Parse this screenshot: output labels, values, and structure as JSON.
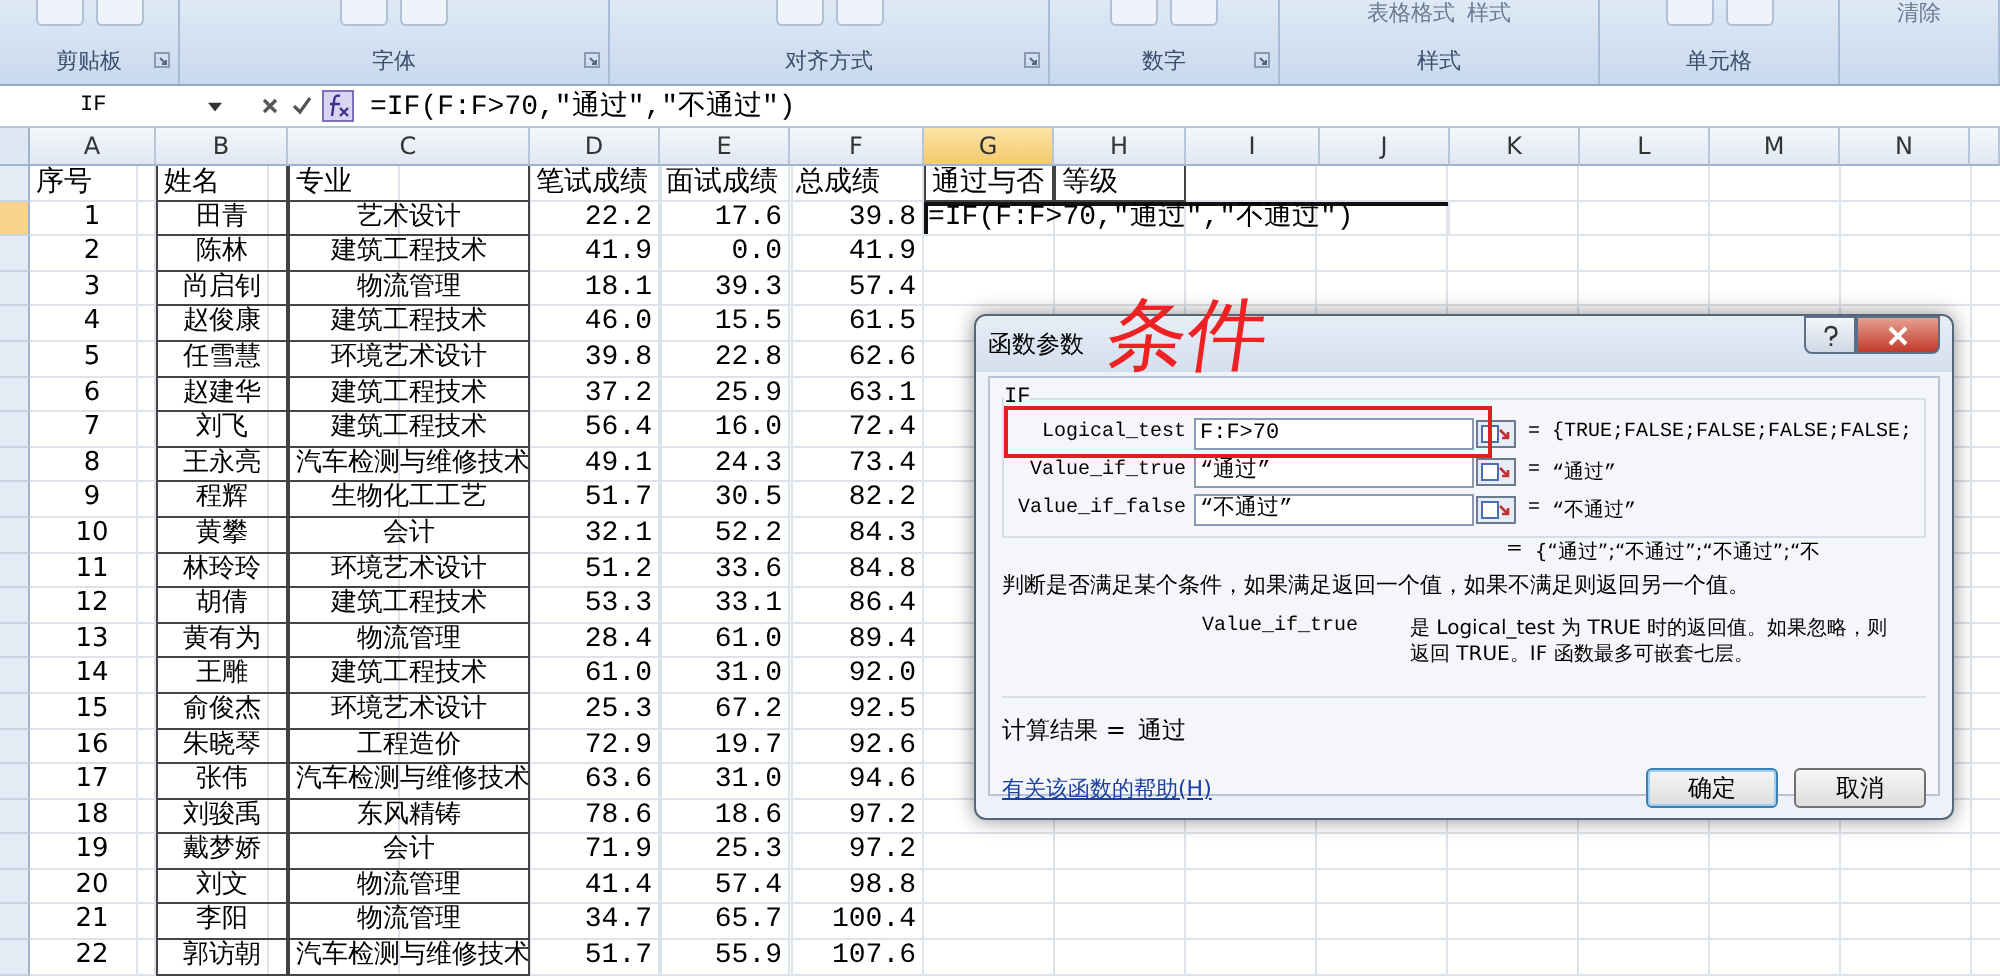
{
  "ribbon": {
    "groups": [
      {
        "label": "剪贴板",
        "launcher": true
      },
      {
        "label": "字体",
        "launcher": true
      },
      {
        "label": "对齐方式",
        "launcher": true
      },
      {
        "label": "数字",
        "launcher": true
      },
      {
        "label": "样式",
        "launcher": false,
        "commands": [
          "表格格式",
          "样式"
        ]
      },
      {
        "label": "单元格",
        "launcher": false
      },
      {
        "launcher": false,
        "commands": [
          "清除"
        ]
      }
    ]
  },
  "formula_bar": {
    "name_box": "IF",
    "formula": "=IF(F:F>70,\"通过\",\"不通过\")"
  },
  "columns": [
    {
      "label": "A",
      "selected": false
    },
    {
      "label": "B",
      "selected": false
    },
    {
      "label": "C",
      "selected": false
    },
    {
      "label": "D",
      "selected": false
    },
    {
      "label": "E",
      "selected": false
    },
    {
      "label": "F",
      "selected": false
    },
    {
      "label": "G",
      "selected": true
    },
    {
      "label": "H",
      "selected": false
    },
    {
      "label": "I",
      "selected": false
    },
    {
      "label": "J",
      "selected": false
    },
    {
      "label": "K",
      "selected": false
    },
    {
      "label": "L",
      "selected": false
    },
    {
      "label": "M",
      "selected": false
    },
    {
      "label": "N",
      "selected": false
    }
  ],
  "header": [
    "序号",
    "姓名",
    "专业",
    "笔试成绩",
    "面试成绩",
    "总成绩",
    "通过与否",
    "等级"
  ],
  "editing_cell": "=IF(F:F>70,\"通过\",\"不通过\")",
  "rows": [
    [
      "1",
      "田青",
      "艺术设计",
      "22.2",
      "17.6",
      "39.8"
    ],
    [
      "2",
      "陈林",
      "建筑工程技术",
      "41.9",
      "0.0",
      "41.9"
    ],
    [
      "3",
      "尚启钊",
      "物流管理",
      "18.1",
      "39.3",
      "57.4"
    ],
    [
      "4",
      "赵俊康",
      "建筑工程技术",
      "46.0",
      "15.5",
      "61.5"
    ],
    [
      "5",
      "任雪慧",
      "环境艺术设计",
      "39.8",
      "22.8",
      "62.6"
    ],
    [
      "6",
      "赵建华",
      "建筑工程技术",
      "37.2",
      "25.9",
      "63.1"
    ],
    [
      "7",
      "刘飞",
      "建筑工程技术",
      "56.4",
      "16.0",
      "72.4"
    ],
    [
      "8",
      "王永亮",
      "汽车检测与维修技术",
      "49.1",
      "24.3",
      "73.4"
    ],
    [
      "9",
      "程辉",
      "生物化工工艺",
      "51.7",
      "30.5",
      "82.2"
    ],
    [
      "10",
      "黄攀",
      "会计",
      "32.1",
      "52.2",
      "84.3"
    ],
    [
      "11",
      "林玲玲",
      "环境艺术设计",
      "51.2",
      "33.6",
      "84.8"
    ],
    [
      "12",
      "胡倩",
      "建筑工程技术",
      "53.3",
      "33.1",
      "86.4"
    ],
    [
      "13",
      "黄有为",
      "物流管理",
      "28.4",
      "61.0",
      "89.4"
    ],
    [
      "14",
      "王雕",
      "建筑工程技术",
      "61.0",
      "31.0",
      "92.0"
    ],
    [
      "15",
      "俞俊杰",
      "环境艺术设计",
      "25.3",
      "67.2",
      "92.5"
    ],
    [
      "16",
      "朱晓琴",
      "工程造价",
      "72.9",
      "19.7",
      "92.6"
    ],
    [
      "17",
      "张伟",
      "汽车检测与维修技术",
      "63.6",
      "31.0",
      "94.6"
    ],
    [
      "18",
      "刘骏禹",
      "东风精铸",
      "78.6",
      "18.6",
      "97.2"
    ],
    [
      "19",
      "戴梦娇",
      "会计",
      "71.9",
      "25.3",
      "97.2"
    ],
    [
      "20",
      "刘文",
      "物流管理",
      "41.4",
      "57.4",
      "98.8"
    ],
    [
      "21",
      "李阳",
      "物流管理",
      "34.7",
      "65.7",
      "100.4"
    ],
    [
      "22",
      "郭访朝",
      "汽车检测与维修技术",
      "51.7",
      "55.9",
      "107.6"
    ]
  ],
  "dialog": {
    "title": "函数参数",
    "function": "IF",
    "args": [
      {
        "name": "Logical_test",
        "value": "F:F>70",
        "sign": "=",
        "result": "{TRUE;FALSE;FALSE;FALSE;FALSE;"
      },
      {
        "name": "Value_if_true",
        "value": "“通过”",
        "sign": "=",
        "result": "“通过”"
      },
      {
        "name": "Value_if_false",
        "value": "“不通过”",
        "sign": "=",
        "result": "“不通过”"
      }
    ],
    "overall_sign": "=",
    "overall_result": "{“通过”;“不通过”;“不通过”;“不",
    "description": "判断是否满足某个条件，如果满足返回一个值，如果不满足则返回另一个值。",
    "param_name": "Value_if_true",
    "param_help": "是 Logical_test 为 TRUE 时的返回值。如果忽略，则返回 TRUE。IF 函数最多可嵌套七层。",
    "calc_label": "计算结果 =",
    "calc_value": "通过",
    "help_link": "有关该函数的帮助(H)",
    "buttons": [
      "确定",
      "取消"
    ],
    "annotation": "条件"
  }
}
